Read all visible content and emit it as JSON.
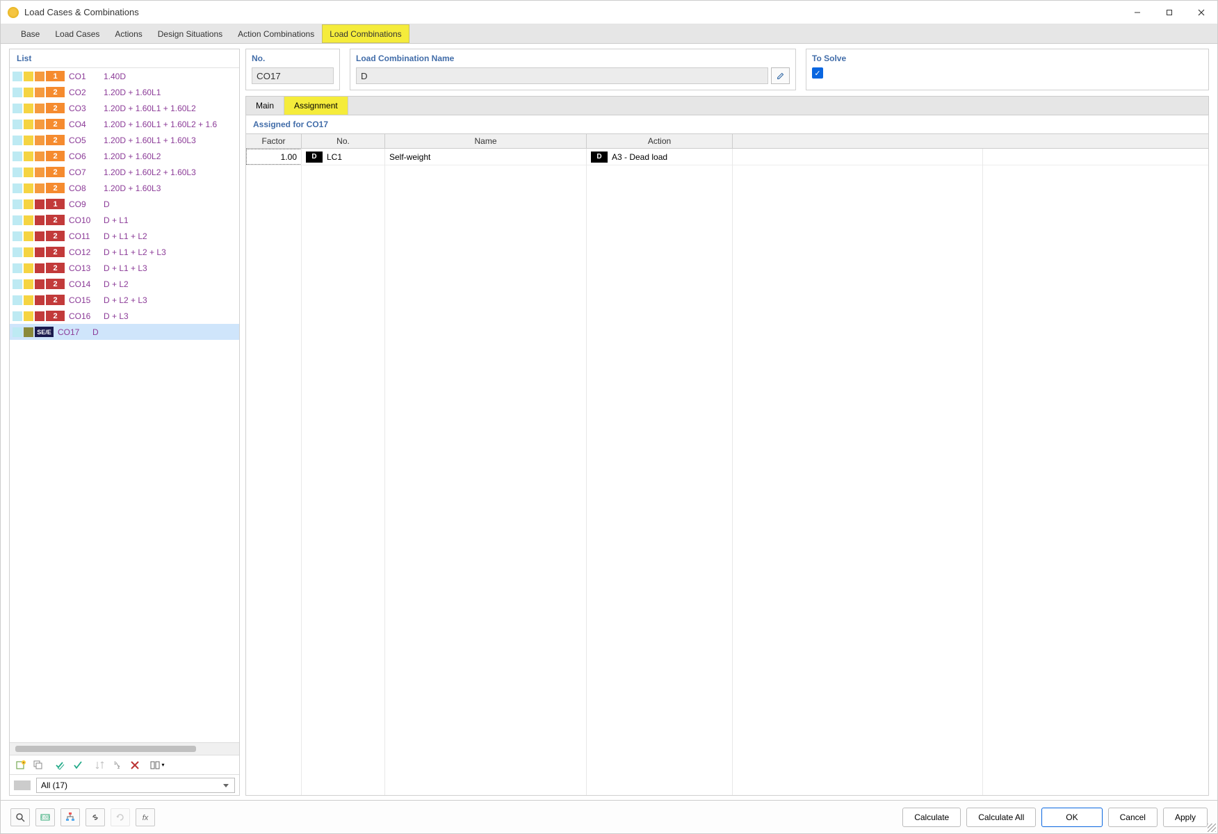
{
  "window": {
    "title": "Load Cases & Combinations"
  },
  "tabs": [
    "Base",
    "Load Cases",
    "Actions",
    "Design Situations",
    "Action Combinations",
    "Load Combinations"
  ],
  "active_tab": 5,
  "list": {
    "header": "List",
    "filter_text": "All (17)",
    "items": [
      {
        "chips": [
          "cyan",
          "yellow",
          "orange"
        ],
        "badge": "1",
        "bclass": "orange",
        "id": "CO1",
        "desc": "1.40D"
      },
      {
        "chips": [
          "cyan",
          "yellow",
          "orange"
        ],
        "badge": "2",
        "bclass": "orange",
        "id": "CO2",
        "desc": "1.20D + 1.60L1"
      },
      {
        "chips": [
          "cyan",
          "yellow",
          "orange"
        ],
        "badge": "2",
        "bclass": "orange",
        "id": "CO3",
        "desc": "1.20D + 1.60L1 + 1.60L2"
      },
      {
        "chips": [
          "cyan",
          "yellow",
          "orange"
        ],
        "badge": "2",
        "bclass": "orange",
        "id": "CO4",
        "desc": "1.20D + 1.60L1 + 1.60L2 + 1.6"
      },
      {
        "chips": [
          "cyan",
          "yellow",
          "orange"
        ],
        "badge": "2",
        "bclass": "orange",
        "id": "CO5",
        "desc": "1.20D + 1.60L1 + 1.60L3"
      },
      {
        "chips": [
          "cyan",
          "yellow",
          "orange"
        ],
        "badge": "2",
        "bclass": "orange",
        "id": "CO6",
        "desc": "1.20D + 1.60L2"
      },
      {
        "chips": [
          "cyan",
          "yellow",
          "orange"
        ],
        "badge": "2",
        "bclass": "orange",
        "id": "CO7",
        "desc": "1.20D + 1.60L2 + 1.60L3"
      },
      {
        "chips": [
          "cyan",
          "yellow",
          "orange"
        ],
        "badge": "2",
        "bclass": "orange",
        "id": "CO8",
        "desc": "1.20D + 1.60L3"
      },
      {
        "chips": [
          "cyan",
          "yellow",
          "red"
        ],
        "badge": "1",
        "bclass": "red",
        "id": "CO9",
        "desc": "D"
      },
      {
        "chips": [
          "cyan",
          "yellow",
          "red"
        ],
        "badge": "2",
        "bclass": "red",
        "id": "CO10",
        "desc": "D + L1"
      },
      {
        "chips": [
          "cyan",
          "yellow",
          "red"
        ],
        "badge": "2",
        "bclass": "red",
        "id": "CO11",
        "desc": "D + L1 + L2"
      },
      {
        "chips": [
          "cyan",
          "yellow",
          "red"
        ],
        "badge": "2",
        "bclass": "red",
        "id": "CO12",
        "desc": "D + L1 + L2 + L3"
      },
      {
        "chips": [
          "cyan",
          "yellow",
          "red"
        ],
        "badge": "2",
        "bclass": "red",
        "id": "CO13",
        "desc": "D + L1 + L3"
      },
      {
        "chips": [
          "cyan",
          "yellow",
          "red"
        ],
        "badge": "2",
        "bclass": "red",
        "id": "CO14",
        "desc": "D + L2"
      },
      {
        "chips": [
          "cyan",
          "yellow",
          "red"
        ],
        "badge": "2",
        "bclass": "red",
        "id": "CO15",
        "desc": "D + L2 + L3"
      },
      {
        "chips": [
          "cyan",
          "yellow",
          "red"
        ],
        "badge": "2",
        "bclass": "red",
        "id": "CO16",
        "desc": "D + L3"
      },
      {
        "chips": [
          "cyan",
          "olive"
        ],
        "badge": "SE/E",
        "bclass": "navy",
        "id": "CO17",
        "desc": "D",
        "selected": true
      }
    ]
  },
  "form": {
    "no_label": "No.",
    "no_value": "CO17",
    "name_label": "Load Combination Name",
    "name_value": "D",
    "solve_label": "To Solve"
  },
  "subtabs": [
    "Main",
    "Assignment"
  ],
  "active_subtab": 1,
  "assign": {
    "header": "Assigned for CO17",
    "columns": [
      "Factor",
      "No.",
      "Name",
      "Action"
    ],
    "rows": [
      {
        "factor": "1.00",
        "tag": "D",
        "no": "LC1",
        "name": "Self-weight",
        "atag": "D",
        "action": "A3 - Dead load"
      }
    ]
  },
  "buttons": {
    "calculate": "Calculate",
    "calculate_all": "Calculate All",
    "ok": "OK",
    "cancel": "Cancel",
    "apply": "Apply"
  }
}
